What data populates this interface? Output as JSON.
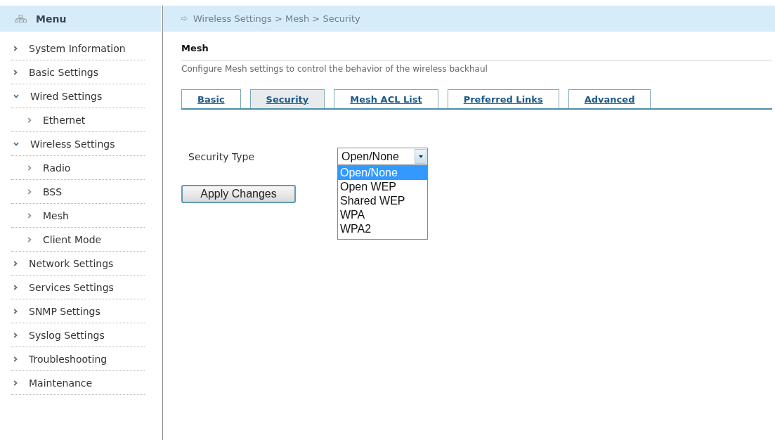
{
  "sidebar": {
    "title": "Menu",
    "items": [
      {
        "label": "System Information",
        "expanded": false
      },
      {
        "label": "Basic Settings",
        "expanded": false
      },
      {
        "label": "Wired Settings",
        "expanded": true,
        "children": [
          {
            "label": "Ethernet"
          }
        ]
      },
      {
        "label": "Wireless Settings",
        "expanded": true,
        "children": [
          {
            "label": "Radio"
          },
          {
            "label": "BSS"
          },
          {
            "label": "Mesh"
          },
          {
            "label": "Client Mode"
          }
        ]
      },
      {
        "label": "Network Settings",
        "expanded": false
      },
      {
        "label": "Services Settings",
        "expanded": false
      },
      {
        "label": "SNMP Settings",
        "expanded": false
      },
      {
        "label": "Syslog Settings",
        "expanded": false
      },
      {
        "label": "Troubleshooting",
        "expanded": false
      },
      {
        "label": "Maintenance",
        "expanded": false
      }
    ]
  },
  "breadcrumb": "Wireless Settings > Mesh > Security",
  "section": {
    "title": "Mesh",
    "description": "Configure Mesh settings to control the behavior of the wireless backhaul"
  },
  "tabs": [
    {
      "label": "Basic",
      "selected": false
    },
    {
      "label": "Security",
      "selected": true
    },
    {
      "label": "Mesh ACL List",
      "selected": false
    },
    {
      "label": "Preferred Links",
      "selected": false
    },
    {
      "label": "Advanced",
      "selected": false
    }
  ],
  "form": {
    "fields": [
      {
        "label": "Security Type",
        "value": "Open/None",
        "expanded": true,
        "options": [
          {
            "label": "Open/None",
            "selected": true
          },
          {
            "label": "Open WEP",
            "selected": false
          },
          {
            "label": "Shared WEP",
            "selected": false
          },
          {
            "label": "WPA",
            "selected": false
          },
          {
            "label": "WPA2",
            "selected": false
          }
        ]
      }
    ],
    "buttons": [
      "Apply Changes"
    ]
  }
}
